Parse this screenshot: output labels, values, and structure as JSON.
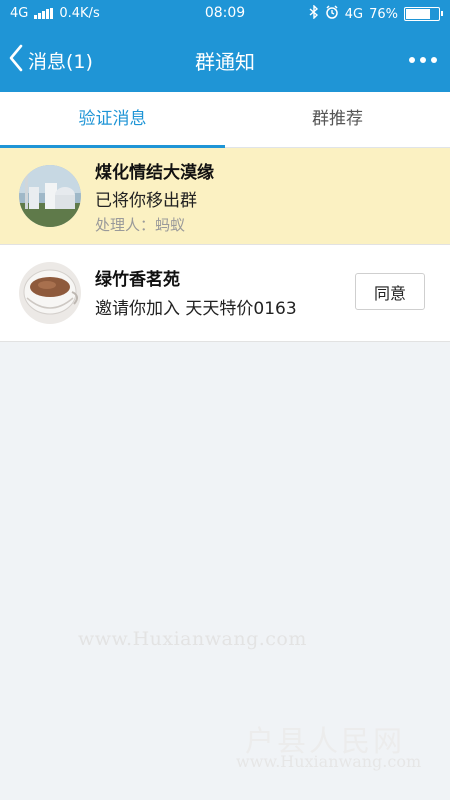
{
  "status_bar": {
    "network": "4G",
    "speed": "0.4K/s",
    "time": "08:09",
    "network_right": "4G",
    "battery_percent": "76%",
    "battery_level": 0.76
  },
  "nav": {
    "back_label": "消息(1)",
    "title": "群通知"
  },
  "tabs": [
    {
      "label": "验证消息",
      "active": true
    },
    {
      "label": "群推荐",
      "active": false
    }
  ],
  "notifications": [
    {
      "name": "煤化情结大漠缘",
      "message": "已将你移出群",
      "handler": "处理人：蚂蚁"
    },
    {
      "name": "绿竹香茗苑",
      "message": "邀请你加入 天天特价0163",
      "action_label": "同意"
    }
  ],
  "watermarks": {
    "url": "www.Huxianwang.com",
    "brand": "户县人民网",
    "url_small": "www.Huxianwang.com"
  },
  "colors": {
    "accent": "#1f95d6",
    "highlight_row": "#fbf1c2"
  }
}
